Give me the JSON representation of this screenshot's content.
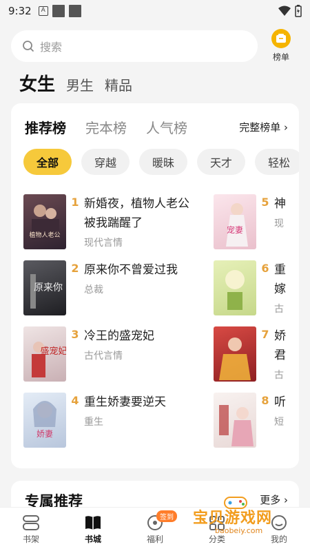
{
  "status": {
    "time": "9:32",
    "notif_glyph": "A"
  },
  "search": {
    "placeholder": "搜索"
  },
  "rank_entry": {
    "label": "榜单"
  },
  "gender_tabs": [
    "女生",
    "男生",
    "精品"
  ],
  "ranking": {
    "tabs": [
      "推荐榜",
      "完本榜",
      "人气榜"
    ],
    "full_list": "完整榜单 ›",
    "chips": [
      "全部",
      "穿越",
      "暖昧",
      "天才",
      "轻松"
    ],
    "books": [
      {
        "rank": "1",
        "title": "新婚夜，植物人老公被我踹醒了",
        "sub": "现代言情",
        "cover_color": "#4a3440",
        "cover_text": "植物人老公"
      },
      {
        "rank": "2",
        "title": "原来你不曾爱过我",
        "sub": "总裁",
        "cover_color": "#3a3a3e",
        "cover_text": "原来你"
      },
      {
        "rank": "3",
        "title": "冷王的盛宠妃",
        "sub": "古代言情",
        "cover_color": "#d9c8c8",
        "cover_text": "盛宠妃"
      },
      {
        "rank": "4",
        "title": "重生娇妻要逆天",
        "sub": "重生",
        "cover_color": "#cfd8e8",
        "cover_text": "娇妻"
      },
      {
        "rank": "5",
        "title": "神",
        "sub": "现",
        "cover_color": "#f4d7df",
        "cover_text": "宠妻"
      },
      {
        "rank": "6",
        "title": "重嫁",
        "sub": "古",
        "cover_color": "#d8e6a6",
        "cover_text": ""
      },
      {
        "rank": "7",
        "title": "娇君",
        "sub": "古",
        "cover_color": "#c9393a",
        "cover_text": ""
      },
      {
        "rank": "8",
        "title": "听",
        "sub": "短",
        "cover_color": "#f3ecea",
        "cover_text": ""
      }
    ]
  },
  "section2": {
    "title": "专属推荐",
    "more": "更多 ›"
  },
  "bottom_nav": [
    {
      "label": "书架",
      "icon": "bookshelf-icon"
    },
    {
      "label": "书城",
      "icon": "book-store-icon"
    },
    {
      "label": "福利",
      "icon": "gift-icon",
      "badge": "签到"
    },
    {
      "label": "分类",
      "icon": "category-icon"
    },
    {
      "label": "我的",
      "icon": "profile-icon"
    }
  ],
  "watermark": {
    "main": "宝贝游戏网",
    "url": "baobeiy.com"
  },
  "colors": {
    "accent": "#f6c93b",
    "rank_number": "#e6a23c",
    "badge": "#ff7d2a"
  }
}
